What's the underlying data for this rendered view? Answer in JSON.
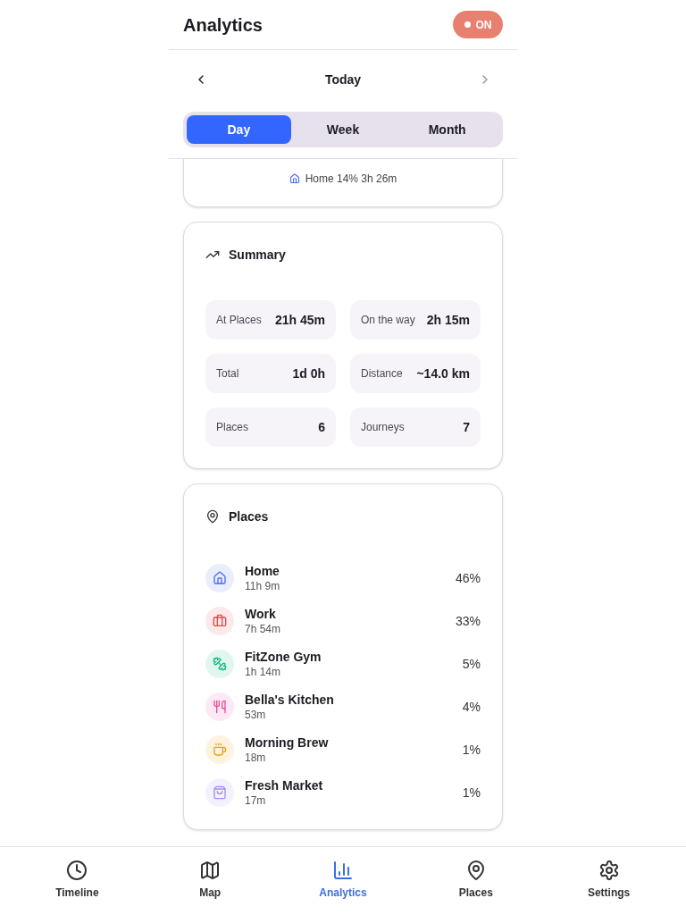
{
  "header": {
    "title": "Analytics",
    "tracking": {
      "label": "ON",
      "on": true
    }
  },
  "date_nav": {
    "label": "Today",
    "prev_disabled": false,
    "next_disabled": true
  },
  "period_tabs": [
    {
      "label": "Day",
      "selected": true
    },
    {
      "label": "Week",
      "selected": false
    },
    {
      "label": "Month",
      "selected": false
    }
  ],
  "breakdown_card": {
    "legend": [
      {
        "kind": "home",
        "label": "Home 14% 3h 26m",
        "color": "#4a6cf0"
      }
    ]
  },
  "summary": {
    "title": "Summary",
    "stats": [
      {
        "label": "At Places",
        "value": "21h 45m"
      },
      {
        "label": "On the way",
        "value": "2h 15m"
      },
      {
        "label": "Total",
        "value": "1d 0h"
      },
      {
        "label": "Distance",
        "value": "~14.0 km"
      },
      {
        "label": "Places",
        "value": "6"
      },
      {
        "label": "Journeys",
        "value": "7"
      }
    ]
  },
  "places": {
    "title": "Places",
    "items": [
      {
        "kind": "home",
        "name": "Home",
        "duration": "11h 9m",
        "share": "46%",
        "color": "#4a6cf0"
      },
      {
        "kind": "work",
        "name": "Work",
        "duration": "7h 54m",
        "share": "33%",
        "color": "#e5484d"
      },
      {
        "kind": "gym",
        "name": "FitZone Gym",
        "duration": "1h 14m",
        "share": "5%",
        "color": "#10b981"
      },
      {
        "kind": "restaurant",
        "name": "Bella's Kitchen",
        "duration": "53m",
        "share": "4%",
        "color": "#ec4899"
      },
      {
        "kind": "cafe",
        "name": "Morning Brew",
        "duration": "18m",
        "share": "1%",
        "color": "#f59e0b"
      },
      {
        "kind": "shop",
        "name": "Fresh Market",
        "duration": "17m",
        "share": "1%",
        "color": "#a78bfa"
      }
    ]
  },
  "bottom_nav": [
    {
      "kind": "timeline",
      "label": "Timeline",
      "selected": false
    },
    {
      "kind": "map",
      "label": "Map",
      "selected": false
    },
    {
      "kind": "analytics",
      "label": "Analytics",
      "selected": true
    },
    {
      "kind": "places",
      "label": "Places",
      "selected": false
    },
    {
      "kind": "settings",
      "label": "Settings",
      "selected": false
    }
  ]
}
